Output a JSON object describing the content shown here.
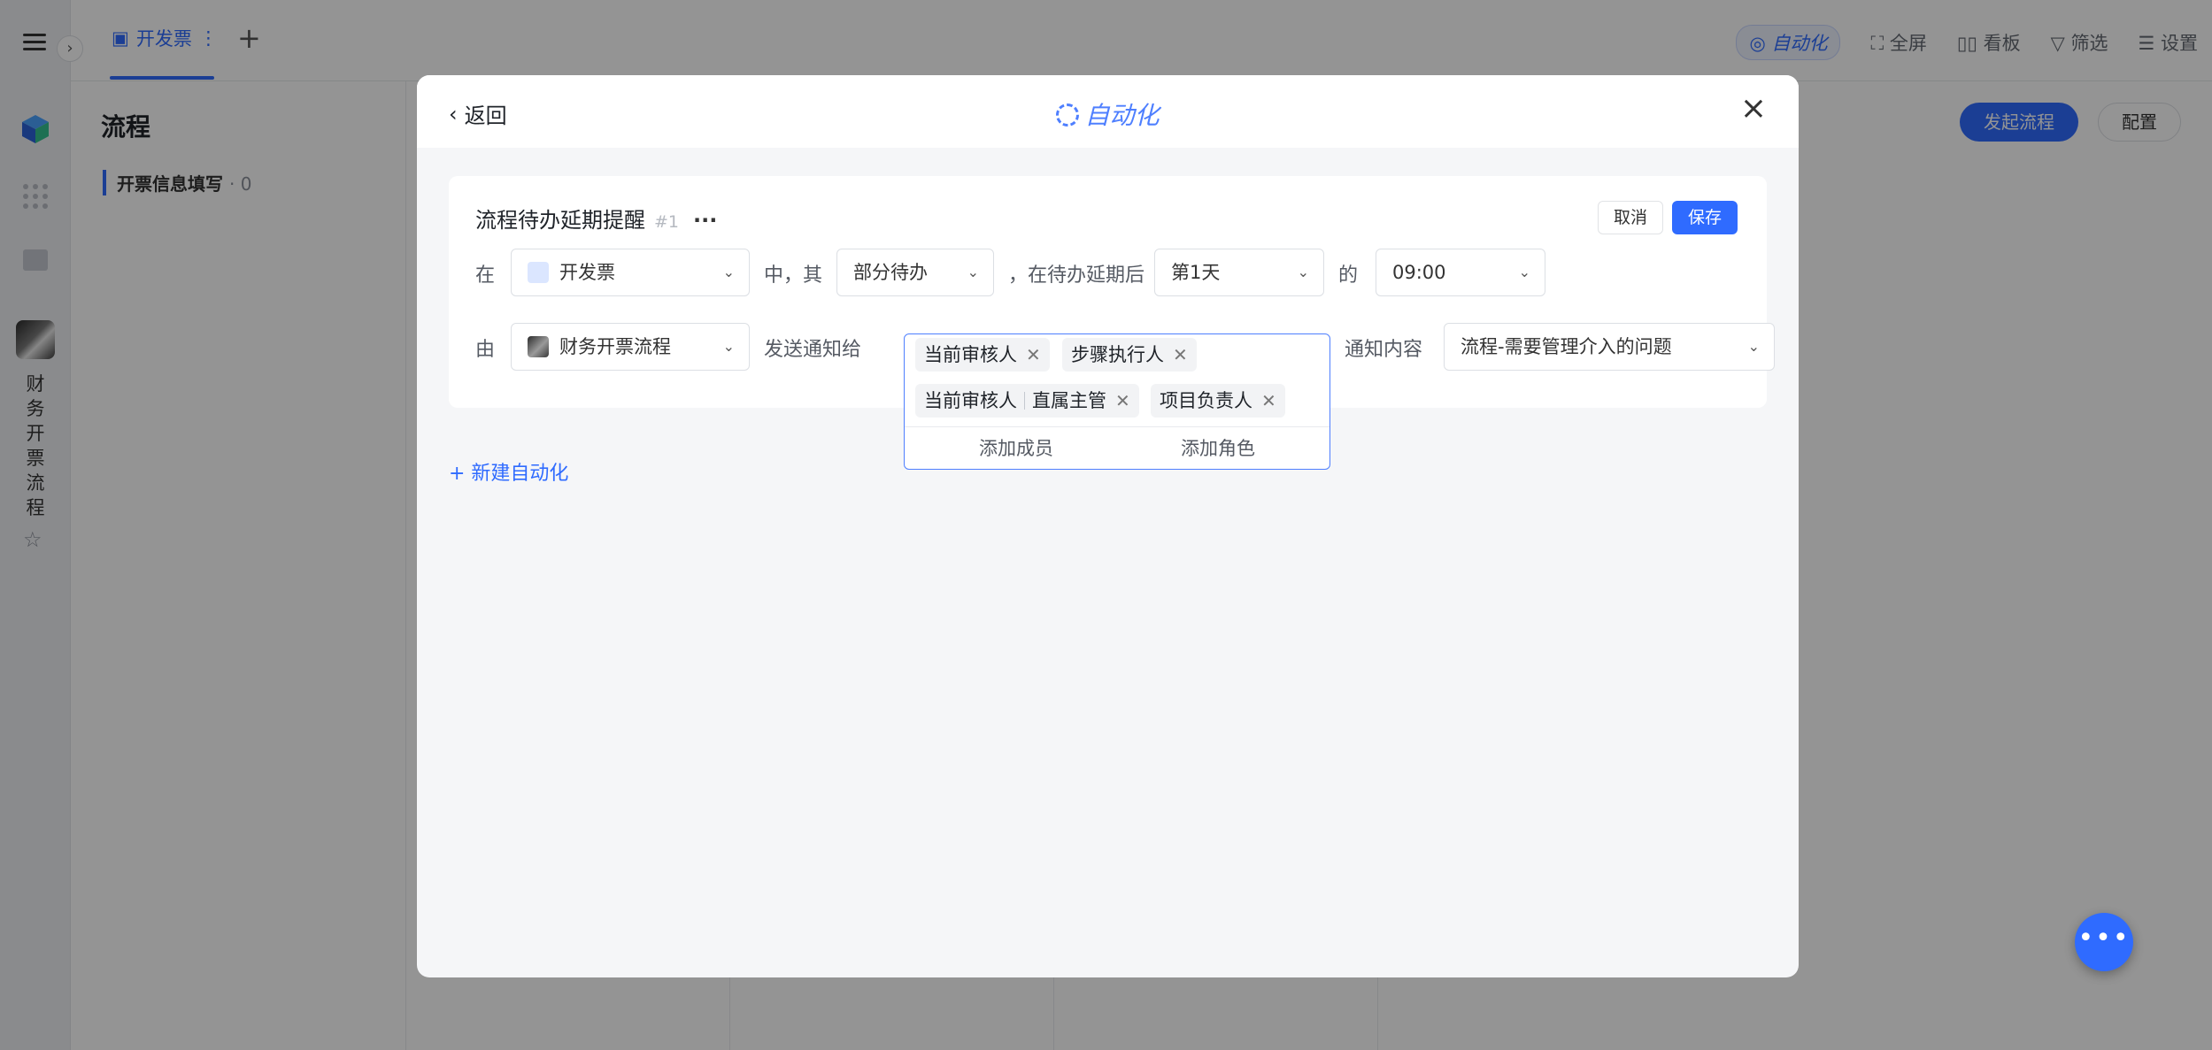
{
  "app": {
    "tab_active": "开发票",
    "tab_add": "+",
    "tools": [
      "全屏",
      "看板",
      "筛选",
      "设置"
    ],
    "tool_automation": "自动化",
    "page_title": "流程",
    "sub_item": "开票信息填写",
    "sub_item_count": "0",
    "btn_start": "发起流程",
    "btn_config": "配置",
    "sidebar_name": [
      "财",
      "务",
      "开",
      "票",
      "流",
      "程"
    ]
  },
  "modal": {
    "back": "返回",
    "title": "自动化",
    "close": "×"
  },
  "card": {
    "title": "流程待办延期提醒",
    "num": "#1",
    "more": "···",
    "cancel": "取消",
    "save": "保存",
    "row1": {
      "lbl_in": "在",
      "form": "开发票",
      "lbl_mid": "中，其",
      "scope": "部分待办",
      "lbl_after": "，在待办延期后",
      "day": "第1天",
      "lbl_of": "的",
      "time": "09:00"
    },
    "row2": {
      "lbl_by": "由",
      "flow": "财务开票流程",
      "lbl_send": "发送通知给",
      "recipients": [
        "当前审核人",
        "步骤执行人",
        "当前审核人",
        "项目负责人"
      ],
      "recipient3_extra": "直属主管",
      "add_member": "添加成员",
      "add_role": "添加角色",
      "lbl_content": "通知内容",
      "content": "流程-需要管理介入的问题"
    }
  },
  "new_automation": "+ 新建自动化",
  "colors": {
    "accent": "#2f6bff",
    "title_blue": "#4e7fff"
  }
}
